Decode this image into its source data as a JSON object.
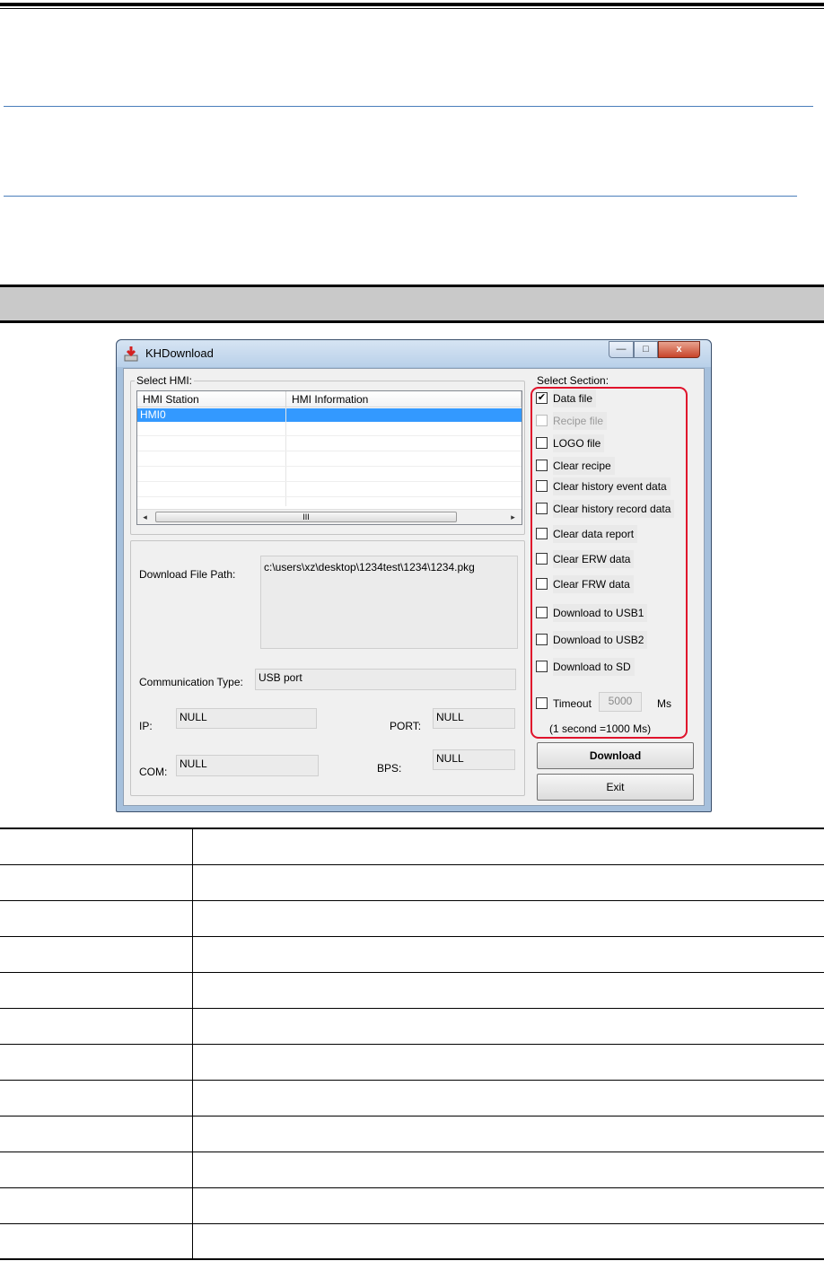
{
  "window": {
    "title": "KHDownload",
    "caption_buttons": {
      "minimize": "—",
      "maximize": "□",
      "close": "x"
    }
  },
  "select_hmi": {
    "group_label": "Select HMI:",
    "columns": [
      "HMI Station",
      "HMI Information"
    ],
    "rows": [
      {
        "station": "HMI0",
        "info": "",
        "selected": true
      }
    ],
    "scrollbar": {
      "left_arrow": "◂",
      "right_arrow": "▸",
      "thumb_grip": "III"
    }
  },
  "download_info": {
    "file_path_label": "Download File Path:",
    "file_path_value": "c:\\users\\xz\\desktop\\1234test\\1234\\1234.pkg",
    "comm_type_label": "Communication Type:",
    "comm_type_value": "USB port",
    "ip_label": "IP:",
    "ip_value": "NULL",
    "port_label": "PORT:",
    "port_value": "NULL",
    "com_label": "COM:",
    "com_value": "NULL",
    "bps_label": "BPS:",
    "bps_value": "NULL"
  },
  "select_section": {
    "group_label": "Select Section:",
    "items": [
      {
        "label": "Data file",
        "checked": true,
        "enabled": true
      },
      {
        "label": "Recipe file",
        "checked": false,
        "enabled": false
      },
      {
        "label": "LOGO file",
        "checked": false,
        "enabled": true
      },
      {
        "label": "Clear recipe",
        "checked": false,
        "enabled": true
      },
      {
        "label": "Clear history event data",
        "checked": false,
        "enabled": true
      },
      {
        "label": "Clear history record data",
        "checked": false,
        "enabled": true
      },
      {
        "label": "Clear data report",
        "checked": false,
        "enabled": true
      },
      {
        "label": "Clear ERW data",
        "checked": false,
        "enabled": true
      },
      {
        "label": "Clear FRW data",
        "checked": false,
        "enabled": true
      },
      {
        "label": "Download to USB1",
        "checked": false,
        "enabled": true
      },
      {
        "label": "Download to USB2",
        "checked": false,
        "enabled": true
      },
      {
        "label": "Download to SD",
        "checked": false,
        "enabled": true
      }
    ],
    "timeout": {
      "label": "Timeout",
      "checked": false,
      "value": "5000",
      "unit": "Ms",
      "note": "(1 second =1000 Ms)"
    }
  },
  "buttons": {
    "download": "Download",
    "exit": "Exit"
  },
  "colors": {
    "highlight_outline": "#e0132c",
    "selection": "#3399ff"
  }
}
